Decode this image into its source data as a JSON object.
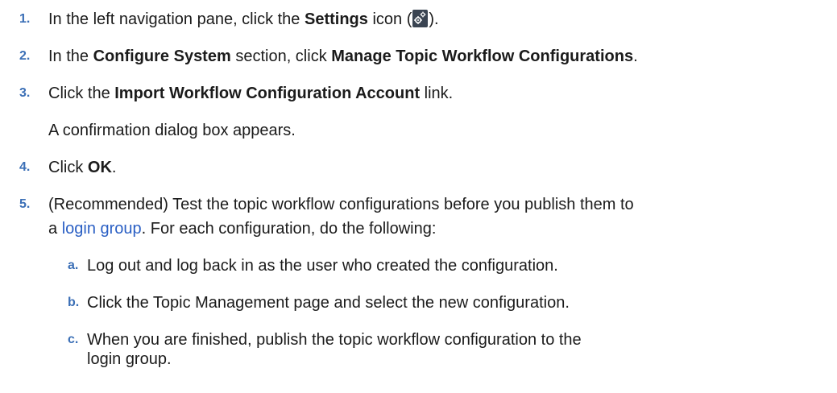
{
  "steps": [
    {
      "num": "1.",
      "before": "In the left navigation pane, click the ",
      "bold": "Settings",
      "after": " icon (",
      "icon": "settings-gear-icon",
      "end": ")."
    },
    {
      "num": "2.",
      "before": "In the ",
      "bold1": "Configure System",
      "middle": " section, click ",
      "bold2": "Manage Topic Workflow Configurations",
      "end": "."
    },
    {
      "num": "3.",
      "before": "Click the ",
      "bold": "Import Workflow Configuration Account",
      "after": " link.",
      "note": "A confirmation dialog box appears."
    },
    {
      "num": "4.",
      "before": "Click ",
      "bold": "OK",
      "end": "."
    },
    {
      "num": "5.",
      "line1": "(Recommended) Test the topic workflow configurations before you publish them to",
      "line2_before": "a ",
      "link": "login group",
      "line2_after": ". For each configuration, do the following:",
      "substeps": [
        {
          "num": "a.",
          "text": "Log out and log back in as the user who created the configuration."
        },
        {
          "num": "b.",
          "text": "Click the Topic Management page and select the new configuration."
        },
        {
          "num": "c.",
          "text": "When you are finished, publish the topic workflow configuration to the login group."
        }
      ]
    }
  ],
  "colors": {
    "number": "#3b6fb6",
    "link": "#2a5fc4",
    "text": "#1b1b1b"
  }
}
